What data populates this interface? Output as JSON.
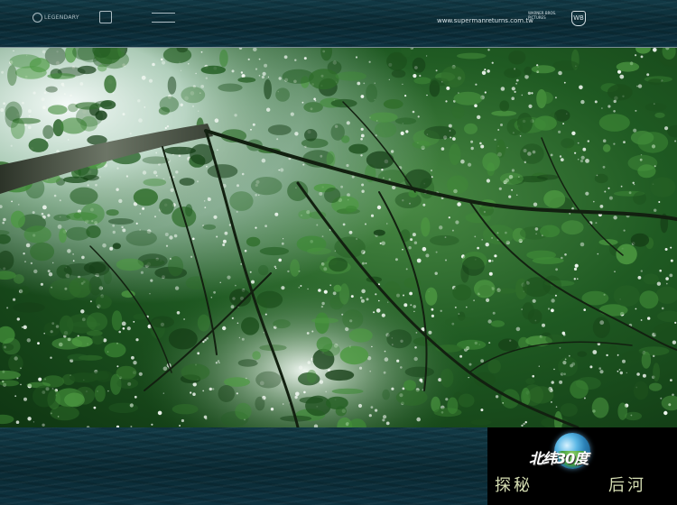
{
  "top_band": {
    "sponsor_logos": [
      "LEGENDARY",
      "",
      ""
    ],
    "site_url": "www.supermanreturns.com.tw",
    "studio_caption": "WARNER BROS. PICTURES"
  },
  "program": {
    "title": "北纬30度",
    "subtitle_left": "探秘",
    "subtitle_right": "后河"
  }
}
